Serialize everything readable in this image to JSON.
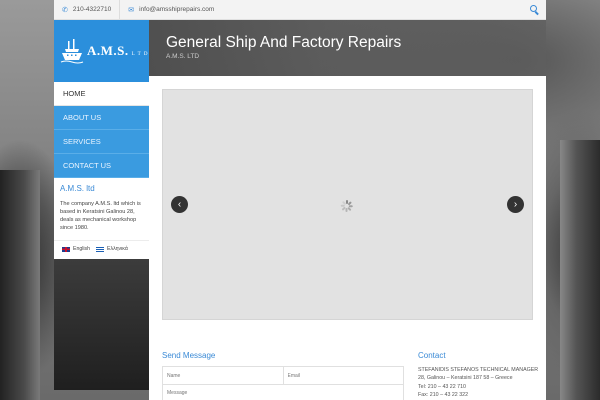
{
  "topbar": {
    "phone": "210-4322710",
    "email": "info@amsshiprepairs.com",
    "icons": {
      "phone": "phone-icon",
      "email": "envelope-icon",
      "search": "search-icon"
    }
  },
  "logo": {
    "text": "A.M.S.",
    "suffix": "L T D",
    "icon": "ship-icon"
  },
  "nav": [
    {
      "label": "HOME",
      "active": true
    },
    {
      "label": "ABOUT US",
      "active": false
    },
    {
      "label": "SERVICES",
      "active": false
    },
    {
      "label": "CONTACT US",
      "active": false
    }
  ],
  "about": {
    "title": "A.M.S. ltd",
    "text": "The company A.M.S. ltd which is based in Keratsini Galinou 28, deals as mechanical workshop since 1980."
  },
  "languages": [
    {
      "label": "English",
      "flag": "uk-flag-icon"
    },
    {
      "label": "Ελληνικά",
      "flag": "greece-flag-icon"
    }
  ],
  "header": {
    "title": "General Ship And Factory Repairs",
    "subtitle": "A.M.S. LTD"
  },
  "slider": {
    "prev": "‹",
    "next": "›"
  },
  "send": {
    "title": "Send Message",
    "name_placeholder": "Name",
    "email_placeholder": "Email",
    "message_placeholder": "Message"
  },
  "contact": {
    "title": "Contact",
    "lines": [
      "STEFANIDIS STEFANOS TECHNICAL MANAGER",
      "28, Galinou – Keratsini 187 58 – Greece",
      "Tel: 210 – 43 22 710",
      "Fax: 210 – 43 22 322"
    ]
  },
  "colors": {
    "accent": "#2b8fdc",
    "nav": "#3a9be0",
    "heading": "#3a8ad6"
  }
}
